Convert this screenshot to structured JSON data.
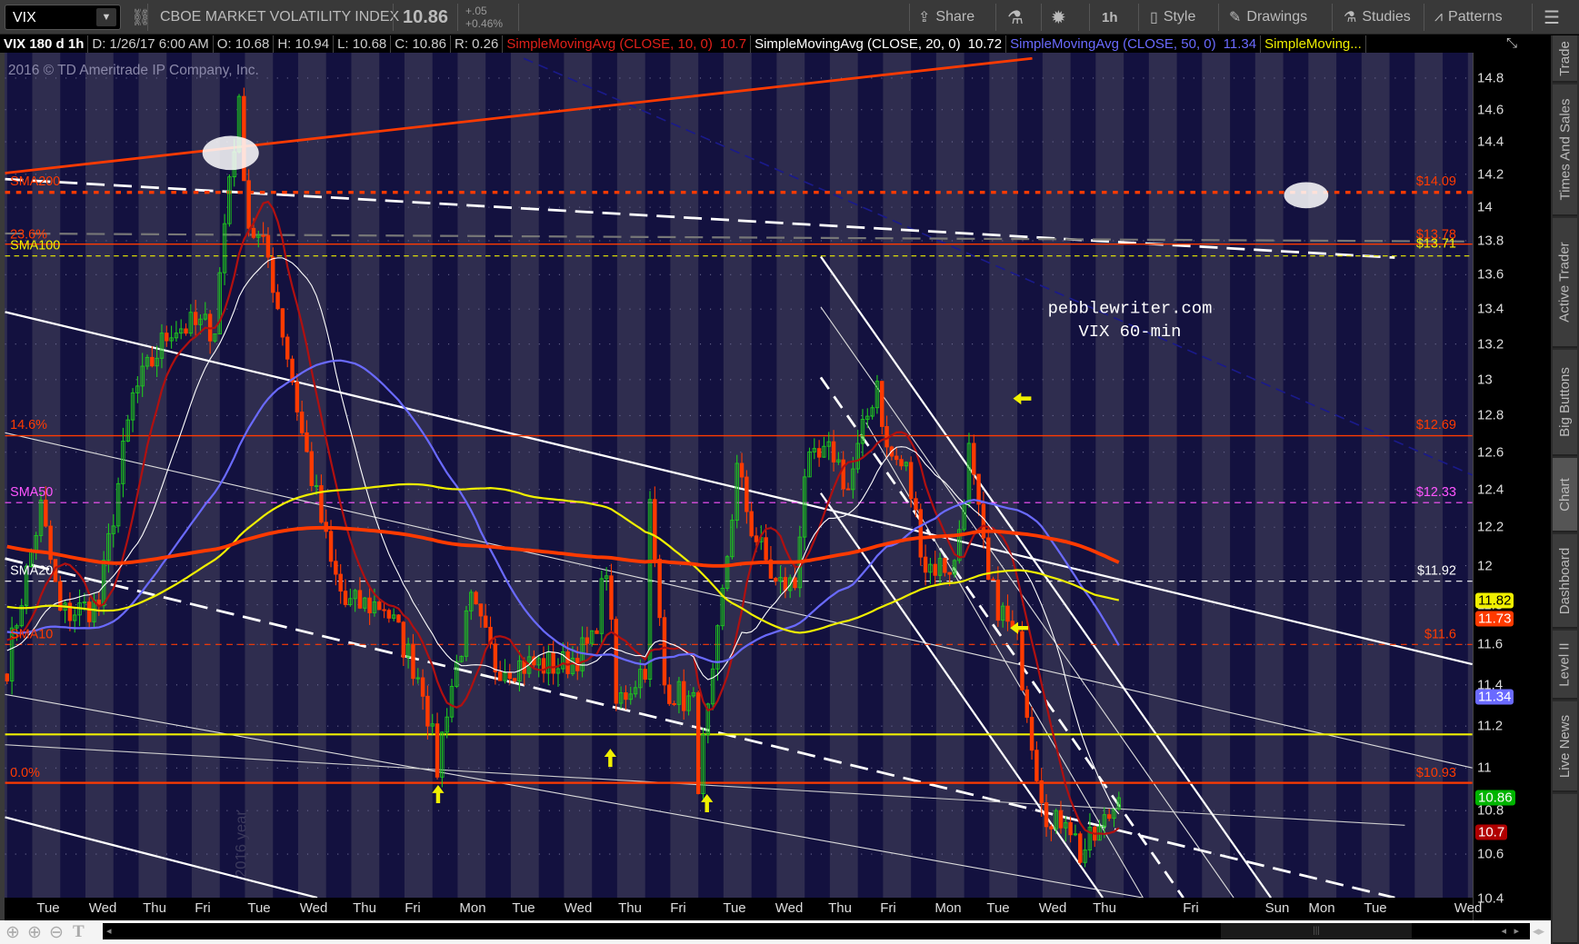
{
  "toolbar": {
    "symbol": "VIX",
    "description": "CBOE MARKET VOLATILITY INDEX",
    "last": "10.86",
    "change": "+.05",
    "change_pct": "+0.46%",
    "share": "Share",
    "timeframe": "1h",
    "style": "Style",
    "drawings": "Drawings",
    "studies": "Studies",
    "patterns": "Patterns"
  },
  "info": {
    "title": "VIX 180 d 1h",
    "date": "D: 1/26/17 6:00 AM",
    "open": "O: 10.68",
    "high": "H: 10.94",
    "low": "L: 10.68",
    "close": "C: 10.86",
    "range": "R: 0.26",
    "studies": [
      {
        "label": "SimpleMovingAvg (CLOSE, 10, 0)",
        "value": "10.7",
        "color": "#e0201a"
      },
      {
        "label": "SimpleMovingAvg (CLOSE, 20, 0)",
        "value": "10.72",
        "color": "#ffffff"
      },
      {
        "label": "SimpleMovingAvg (CLOSE, 50, 0)",
        "value": "11.34",
        "color": "#6a6aff"
      },
      {
        "label": "SimpleMoving...",
        "color": "#f0f000"
      }
    ]
  },
  "watermark": "2016 © TD Ameritrade IP Company, Inc.",
  "year_watermark": "2016 year",
  "annotation": {
    "line1": "pebblewriter.com",
    "line2": "VIX 60-min"
  },
  "level_labels_left": {
    "sma200": "SMA200",
    "fib236": "23.6%",
    "sma100": "SMA100",
    "fib146": "14.6%",
    "sma50": "SMA50",
    "sma20": "SMA20",
    "sma10": "SMA10",
    "fib0": "0.0%"
  },
  "level_labels_right": {
    "l1409": "$14.09",
    "l1378": "$13.78",
    "l1371": "$13.71",
    "l1269": "$12.69",
    "l1233": "$12.33",
    "l1192": "$11.92",
    "l116": "$11.6",
    "l1093": "$10.93"
  },
  "price_axis": {
    "scale": "log",
    "ticks": [
      "14.8",
      "14.6",
      "14.4",
      "14.2",
      "14",
      "13.8",
      "13.6",
      "13.4",
      "13.2",
      "13",
      "12.8",
      "12.6",
      "12.4",
      "12.2",
      "12",
      "11.8",
      "11.6",
      "11.4",
      "11.2",
      "11",
      "10.8",
      "10.6",
      "10.4"
    ]
  },
  "badges": [
    {
      "value": "11.82",
      "bg": "#f0f000",
      "fg": "#000"
    },
    {
      "value": "11.73",
      "bg": "#ff3a00",
      "fg": "#fff"
    },
    {
      "value": "11.34",
      "bg": "#6a6aff",
      "fg": "#fff"
    },
    {
      "value": "10.86",
      "bg": "#00b400",
      "fg": "#fff"
    },
    {
      "value": "10.7",
      "bg": "#b00000",
      "fg": "#fff"
    }
  ],
  "time_axis": [
    "Tue",
    "Wed",
    "Thu",
    "Fri",
    "Tue",
    "Wed",
    "Thu",
    "Fri",
    "Mon",
    "Tue",
    "Wed",
    "Thu",
    "Fri",
    "Tue",
    "Wed",
    "Thu",
    "Fri",
    "Mon",
    "Tue",
    "Wed",
    "Thu",
    "Fri",
    "Sun",
    "Mon",
    "Tue",
    "Wed"
  ],
  "sidebar_tabs": [
    "Trade",
    "Times And Sales",
    "Active Trader",
    "Big Buttons",
    "Chart",
    "Dashboard",
    "Level II",
    "Live News"
  ],
  "active_tab": "Chart",
  "chart_data": {
    "type": "candlestick",
    "symbol": "VIX",
    "interval": "1h",
    "close_keypoints": [
      [
        0,
        11.5
      ],
      [
        7,
        12.3
      ],
      [
        11,
        11.75
      ],
      [
        19,
        11.8
      ],
      [
        26,
        12.9
      ],
      [
        34,
        13.3
      ],
      [
        43,
        13.3
      ],
      [
        46,
        14.2
      ],
      [
        48,
        14.6
      ],
      [
        50,
        13.9
      ],
      [
        54,
        13.7
      ],
      [
        59,
        13.0
      ],
      [
        61,
        12.7
      ],
      [
        67,
        12.0
      ],
      [
        70,
        11.8
      ],
      [
        78,
        11.8
      ],
      [
        82,
        11.6
      ],
      [
        86,
        11.4
      ],
      [
        89,
        11.0
      ],
      [
        91,
        11.3
      ],
      [
        96,
        11.8
      ],
      [
        101,
        11.5
      ],
      [
        107,
        11.5
      ],
      [
        115,
        11.5
      ],
      [
        121,
        11.6
      ],
      [
        124,
        12.0
      ],
      [
        126,
        11.3
      ],
      [
        132,
        11.5
      ],
      [
        133,
        12.3
      ],
      [
        136,
        11.4
      ],
      [
        142,
        11.3
      ],
      [
        143,
        10.95
      ],
      [
        146,
        11.4
      ],
      [
        151,
        12.5
      ],
      [
        154,
        12.2
      ],
      [
        159,
        11.9
      ],
      [
        163,
        11.9
      ],
      [
        165,
        12.5
      ],
      [
        171,
        12.6
      ],
      [
        174,
        12.4
      ],
      [
        180,
        13.0
      ],
      [
        182,
        12.6
      ],
      [
        186,
        12.5
      ],
      [
        190,
        12.0
      ],
      [
        196,
        12.0
      ],
      [
        199,
        12.6
      ],
      [
        203,
        11.9
      ],
      [
        209,
        11.6
      ],
      [
        211,
        11.3
      ],
      [
        213,
        11.0
      ],
      [
        216,
        10.7
      ],
      [
        219,
        10.8
      ],
      [
        222,
        10.6
      ],
      [
        226,
        10.7
      ],
      [
        230,
        10.86
      ]
    ],
    "moving_averages": [
      {
        "period": 10,
        "color": "#b01010"
      },
      {
        "period": 20,
        "color": "#ffffff"
      },
      {
        "period": 50,
        "color": "#6a6aff"
      },
      {
        "period": 100,
        "color": "#f0f000"
      },
      {
        "period": 200,
        "color": "#ff3a00"
      }
    ],
    "horizontal_levels": [
      14.09,
      13.78,
      13.71,
      12.69,
      12.33,
      11.92,
      11.6,
      11.16,
      10.93
    ],
    "y_range": [
      10.4,
      14.9
    ]
  }
}
